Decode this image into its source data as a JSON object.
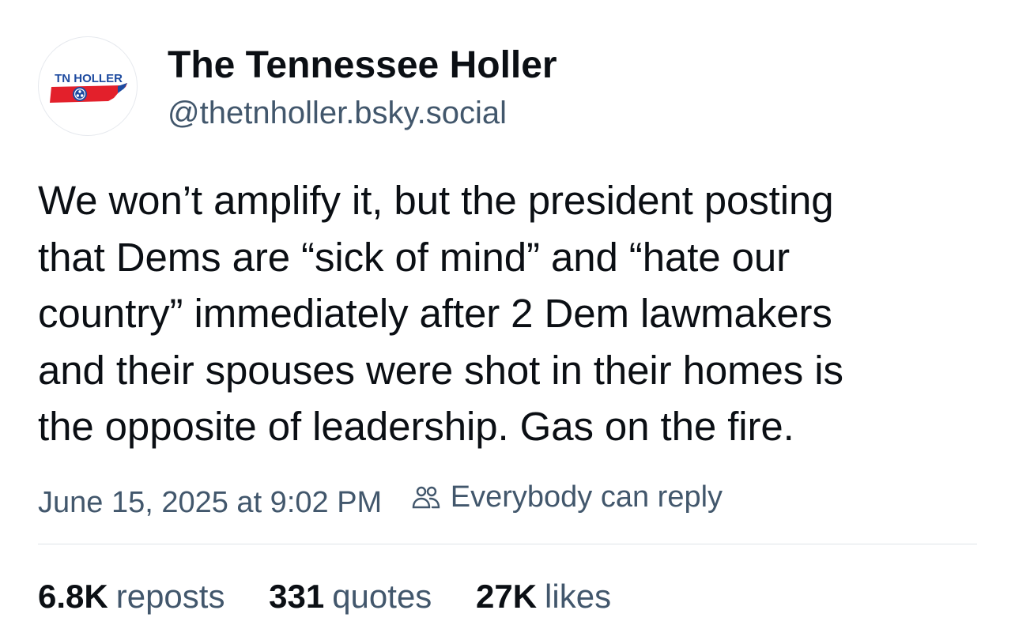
{
  "author": {
    "display_name": "The Tennessee Holler",
    "handle": "@thetnholler.bsky.social",
    "avatar": {
      "logo_text": "TN HOLLER",
      "brand_colors": {
        "red": "#e3202b",
        "blue": "#1e4ba0",
        "white": "#ffffff"
      }
    }
  },
  "post": {
    "text": "We won’t amplify it, but the president posting\nthat Dems are “sick of mind” and “hate our\ncountry” immediately after 2 Dem lawmakers\nand their spouses were shot in their homes is\nthe opposite of leadership. Gas on the fire.",
    "timestamp": "June 15, 2025 at 9:02 PM",
    "reply_setting": {
      "icon": "people-icon",
      "label": "Everybody can reply"
    }
  },
  "stats": {
    "reposts": {
      "count": "6.8K",
      "label": "reposts"
    },
    "quotes": {
      "count": "331",
      "label": "quotes"
    },
    "likes": {
      "count": "27K",
      "label": "likes"
    }
  },
  "colors": {
    "text_primary": "#0b0f14",
    "text_secondary": "#42576c",
    "divider": "#dfe3e8"
  }
}
